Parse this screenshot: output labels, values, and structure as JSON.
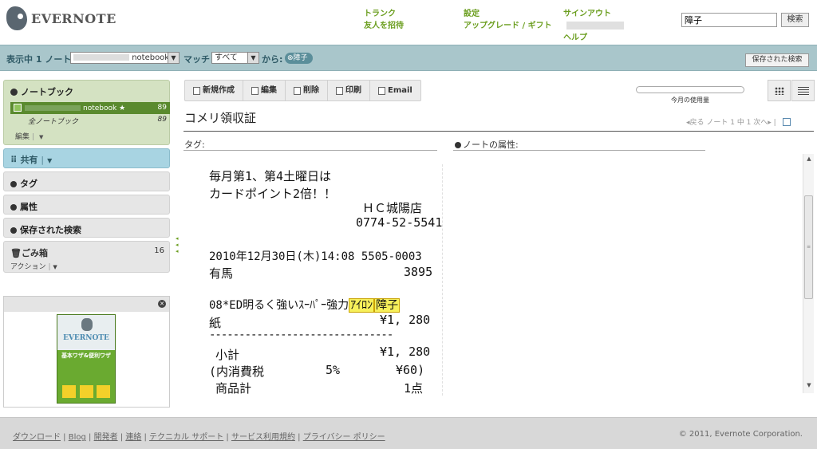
{
  "header": {
    "logo_text": "EVERNOTE",
    "nav": [
      [
        "トランク",
        "友人を招待"
      ],
      [
        "設定",
        "アップグレード / ギフト"
      ],
      [
        "サインアウト",
        "ヘルプ"
      ]
    ],
    "search_value": "障子",
    "search_button": "検索"
  },
  "statusbar": {
    "showing": "表示中 1 ノート",
    "notebook_suffix": "notebook",
    "match_label": "マッチ",
    "match_value": "すべて",
    "from_label": "から:",
    "filter_pill": "障子",
    "saved_search_button": "保存された検索"
  },
  "sidebar": {
    "notebooks_title": "ノートブック",
    "selected_notebook": "notebook ★",
    "selected_count": "89",
    "all_notebooks": "全ノートブック",
    "all_count": "89",
    "edit_label": "編集",
    "shared": "共有",
    "tags": "タグ",
    "attributes": "属性",
    "saved_searches": "保存された検索",
    "trash": "ごみ箱",
    "trash_count": "16",
    "action": "アクション",
    "ad_book_title": "EVERNOTE",
    "ad_book_subtitle": "基本ワザ&便利ワザ"
  },
  "toolbar": {
    "new_note": "新規作成",
    "edit": "編集",
    "delete": "削除",
    "print": "印刷",
    "email": "Email",
    "usage_label": "今月の使用量",
    "usage_fraction": 0.0
  },
  "note": {
    "title": "コメリ領収証",
    "nav": "◂戻る ノート 1 中 1 次へ▸ |",
    "tags_label": "タグ:",
    "attributes_label": "ノートの属性:"
  },
  "receipt": {
    "line1": "毎月第1、第4土曜日は",
    "line2": "カードポイント2倍！！",
    "store": "ＨＣ城陽店",
    "phone": "0774-52-5541",
    "datetime": "2010年12月30日(木)14:08 5505-0003",
    "clerk": "有馬",
    "clerk_no": "3895",
    "item_prefix": "08*ED明るく強いｽｰﾊﾟｰ強力",
    "item_hl1": "ｱｲﾛﾝ",
    "item_hl2": "障子",
    "item_line2": "紙",
    "item_price": "¥1, 280",
    "dashes": "-------------------------------",
    "subtotal_label": "小計",
    "subtotal": "¥1, 280",
    "tax_label": "(内消費税",
    "tax_rate": "5%",
    "tax_amount": "¥60)",
    "count_label": "商品計",
    "count": "1点"
  },
  "footer": {
    "links": [
      "ダウンロード",
      "Blog",
      "開発者",
      "連絡",
      "テクニカル サポート",
      "サービス利用規約",
      "プライバシー ポリシー"
    ],
    "copyright": "© 2011, Evernote Corporation."
  }
}
